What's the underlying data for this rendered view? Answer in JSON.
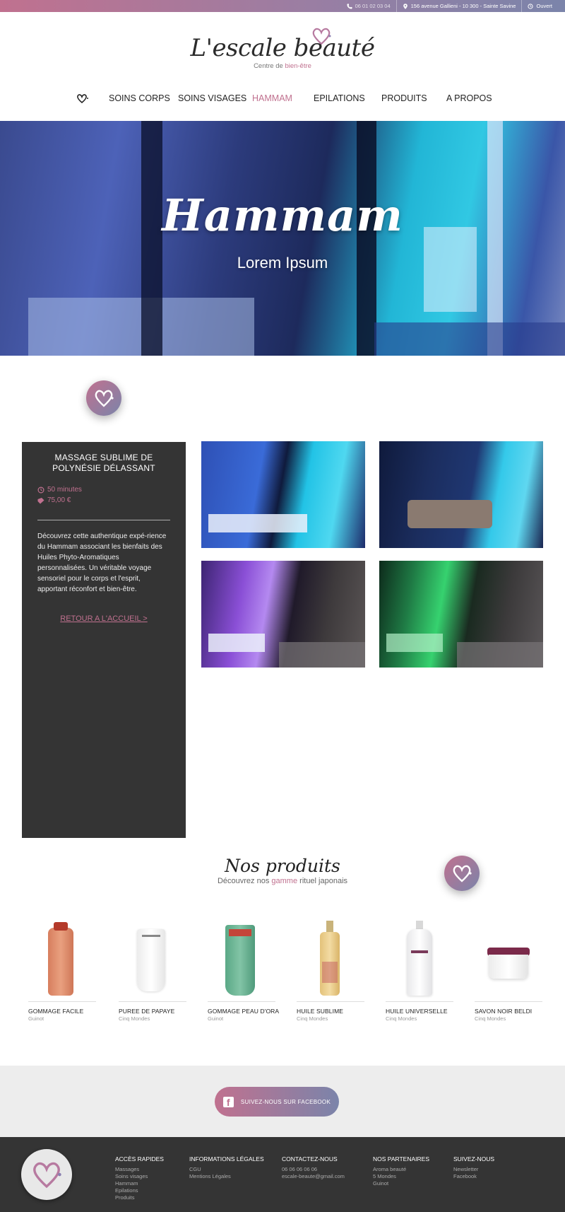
{
  "topbar": {
    "phone": "06 01 02 03 04",
    "address": "156 avenue Gallieni - 10 300 - Sainte Savine",
    "status": "Ouvert",
    "icons": [
      "phone-icon",
      "map-pin-icon",
      "clock-icon"
    ]
  },
  "brand": {
    "name": "L'escale beauté",
    "tagline_prefix": "Centre de ",
    "tagline_accent": "bien-être"
  },
  "nav": {
    "items": [
      {
        "label": "SOINS CORPS"
      },
      {
        "label": "SOINS VISAGES"
      },
      {
        "label": "HAMMAM",
        "active": true
      },
      {
        "label": "EPILATIONS"
      },
      {
        "label": "PRODUITS"
      },
      {
        "label": "A PROPOS"
      }
    ]
  },
  "hero": {
    "title": "Hammam",
    "subtitle": "Lorem Ipsum"
  },
  "service": {
    "title": "MASSAGE SUBLIME DE POLYNÉSIE DÉLASSANT",
    "duration": "50 minutes",
    "price": "75,00 €",
    "description": "Découvrez cette authentique expé-rience du Hammam associant les bienfaits des Huiles Phyto-Aromatiques personnalisées. Un véritable voyage sensoriel pour le corps et l'esprit, apportant réconfort et bien-être.",
    "back_link": "RETOUR A L'ACCUEIL >"
  },
  "products": {
    "title": "Nos produits",
    "subtitle_prefix": "Découvrez nos ",
    "subtitle_accent": "gamme",
    "subtitle_suffix": " rituel japonais",
    "items": [
      {
        "name": "GOMMAGE FACILE",
        "brand": "Guinot"
      },
      {
        "name": "PUREE DE PAPAYE",
        "brand": "Cinq Mondes"
      },
      {
        "name": "GOMMAGE PEAU D'ORA",
        "brand": "Guinot"
      },
      {
        "name": "HUILE SUBLIME",
        "brand": "Cinq Mondes"
      },
      {
        "name": "HUILE UNIVERSELLE",
        "brand": "Cinq Mondes"
      },
      {
        "name": "SAVON NOIR BELDI",
        "brand": "Cinq Mondes"
      }
    ]
  },
  "facebook": {
    "label": "SUIVEZ-NOUS SUR FACEBOOK"
  },
  "footer": {
    "columns": [
      {
        "title": "ACCÈS RAPIDES",
        "links": [
          "Massages",
          "Soins visages",
          "Hammam",
          "Epilations",
          "Produits"
        ]
      },
      {
        "title": "INFORMATIONS LÉGALES",
        "links": [
          "CGU",
          "Mentions Légales"
        ]
      },
      {
        "title": "CONTACTEZ-NOUS",
        "links": [
          "06 06 06 06 06",
          "escale-beaute@gmail.com"
        ]
      },
      {
        "title": "NOS PARTENAIRES",
        "links": [
          "Aroma beauté",
          "5 Mondes",
          "Guinot"
        ]
      },
      {
        "title": "SUIVEZ-NOUS",
        "links": [
          "Newsletter",
          "Facebook"
        ]
      }
    ]
  },
  "colors": {
    "accent": "#c0718f",
    "accent_end": "#7b84aa",
    "dark": "#343434"
  }
}
